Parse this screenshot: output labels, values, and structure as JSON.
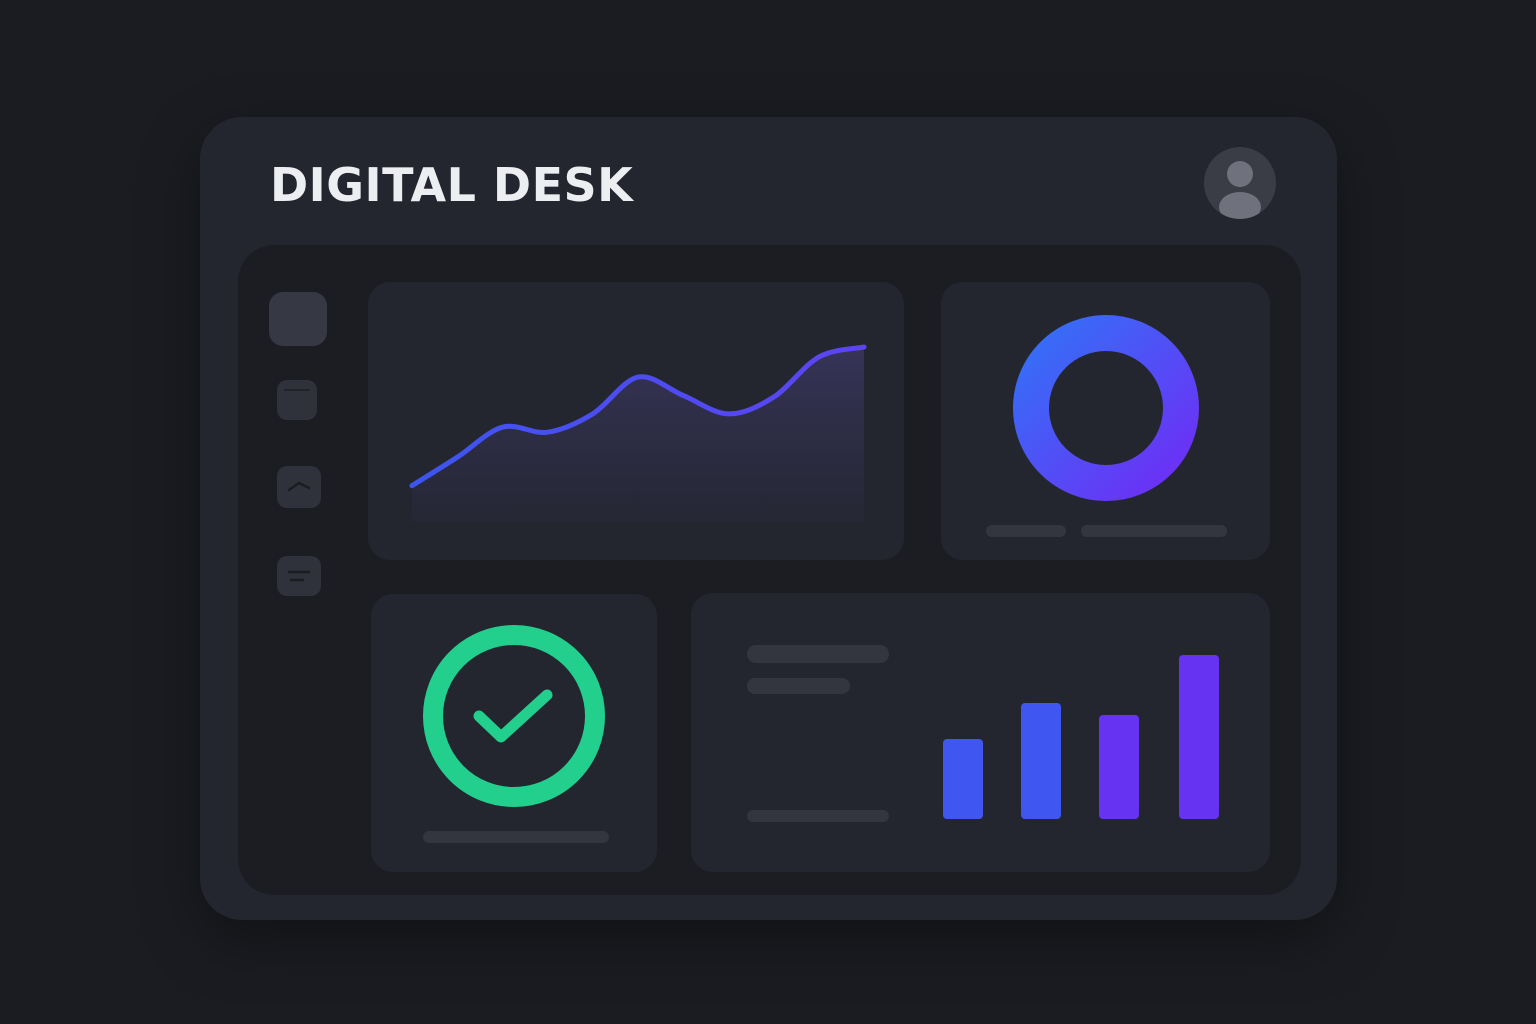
{
  "app": {
    "title": "DIGITAL DESK"
  },
  "header": {
    "avatar_icon": "user-avatar-icon"
  },
  "sidebar": {
    "items": [
      {
        "icon": "home-icon",
        "active": true
      },
      {
        "icon": "window-icon",
        "active": false
      },
      {
        "icon": "trend-icon",
        "active": false
      },
      {
        "icon": "list-icon",
        "active": false
      }
    ]
  },
  "colors": {
    "background": "#1b1c21",
    "window": "#24262f",
    "content": "#1c1d23",
    "card": "#24262f",
    "line_start": "#3d55ef",
    "line_end": "#5d44f2",
    "ring_start": "#3470f6",
    "ring_end": "#6e2ef5",
    "success": "#22cf8c",
    "bar_blue": "#3f56f0",
    "bar_violet": "#6633f3"
  },
  "widgets": {
    "trend_card": {
      "icon": "line-chart"
    },
    "ring_card": {
      "icon": "donut-ring",
      "progress": 1.0
    },
    "status_card": {
      "icon": "check-circle-icon"
    },
    "bars_card": {
      "icon": "bar-chart"
    }
  },
  "chart_data": [
    {
      "type": "line",
      "x": [
        0,
        1,
        2,
        3,
        4,
        5,
        6,
        7,
        8,
        9,
        10
      ],
      "values": [
        5,
        22,
        40,
        37,
        48,
        70,
        59,
        48,
        58,
        82,
        88
      ],
      "ylim": [
        0,
        100
      ]
    },
    {
      "type": "bar",
      "values": [
        40,
        58,
        52,
        82
      ],
      "ylim": [
        0,
        100
      ]
    }
  ]
}
